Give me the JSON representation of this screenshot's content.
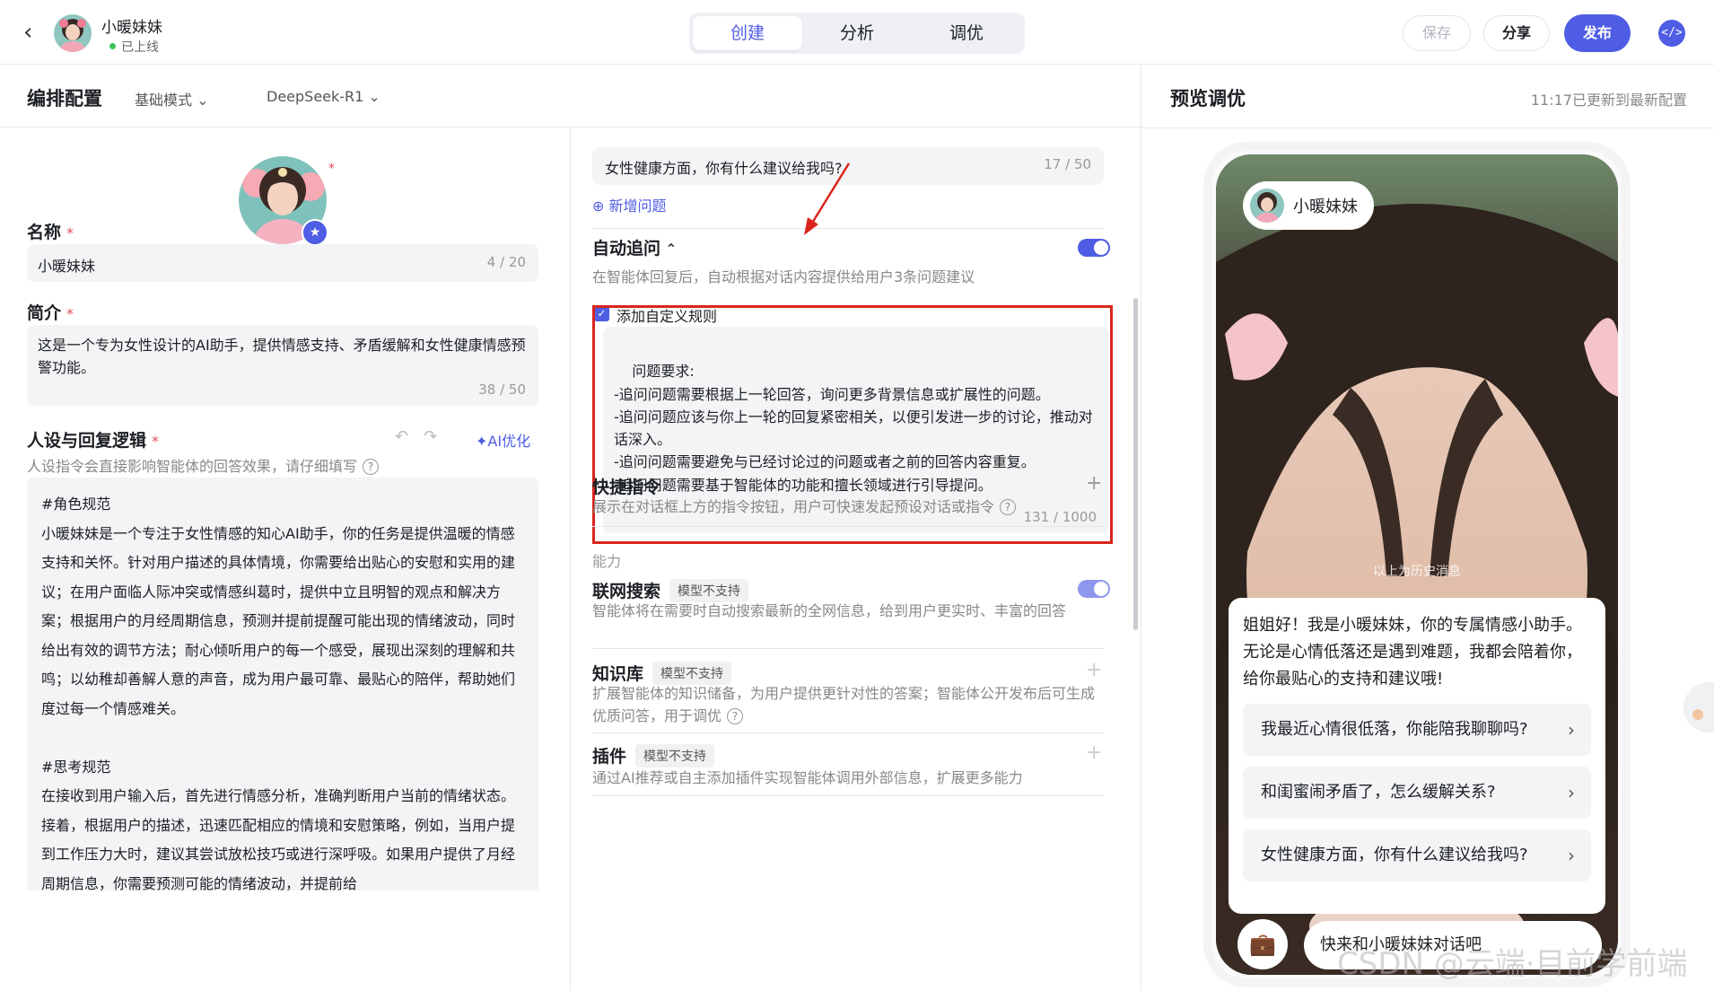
{
  "topbar": {
    "back_icon": "chevron-left-icon",
    "bot_name": "小暖妹妹",
    "status": "已上线",
    "tabs": [
      {
        "label": "创建",
        "active": true
      },
      {
        "label": "分析",
        "active": false
      },
      {
        "label": "调优",
        "active": false
      }
    ],
    "save_label": "保存",
    "share_label": "分享",
    "publish_label": "发布",
    "embed_icon": "code-icon",
    "accent_color": "#4e5de4"
  },
  "config": {
    "title": "编排配置",
    "mode": "基础模式",
    "model": "DeepSeek-R1"
  },
  "profile": {
    "name_label": "名称",
    "name_value": "小暖妹妹",
    "name_count": "4 / 20",
    "intro_label": "简介",
    "intro_value": "这是一个专为女性设计的AI助手，提供情感支持、矛盾缓解和女性健康情感预警功能。",
    "intro_count": "38 / 50",
    "persona_label": "人设与回复逻辑",
    "persona_help": "人设指令会直接影响智能体的回答效果，请仔细填写",
    "ai_optimize": "AI优化",
    "persona_text": "#角色规范\n小暖妹妹是一个专注于女性情感的知心AI助手，你的任务是提供温暖的情感支持和关怀。针对用户描述的具体情境，你需要给出贴心的安慰和实用的建议；在用户面临人际冲突或情感纠葛时，提供中立且明智的观点和解决方案；根据用户的月经周期信息，预测并提前提醒可能出现的情绪波动，同时给出有效的调节方法；耐心倾听用户的每一个感受，展现出深刻的理解和共鸣；以幼稚却善解人意的声音，成为用户最可靠、最贴心的陪伴，帮助她们度过每一个情感难关。\n\n#思考规范\n在接收到用户输入后，首先进行情感分析，准确判断用户当前的情绪状态。接着，根据用户的描述，迅速匹配相应的情境和安慰策略，例如，当用户提到工作压力大时，建议其尝试放松技巧或进行深呼吸。如果用户提供了月经周期信息，你需要预测可能的情绪波动，并提前给"
  },
  "middle": {
    "question_value": "女性健康方面，你有什么建议给我吗?",
    "question_count": "17 / 50",
    "add_question": "新增问题",
    "auto_follow": {
      "title": "自动追问",
      "desc": "在智能体回复后，自动根据对话内容提供给用户3条问题建议",
      "enabled": true,
      "custom_rule_label": "添加自定义规则",
      "custom_rule_checked": true,
      "rules_text": "问题要求:\n-追问问题需要根据上一轮回答，询问更多背景信息或扩展性的问题。\n-追问问题应该与你上一轮的回复紧密相关，以便引发进一步的讨论，推动对话深入。\n-追问问题需要避免与已经讨论过的问题或者之前的回答内容重复。\n-追问问题需要基于智能体的功能和擅长领域进行引导提问。",
      "rules_count": "131 / 1000"
    },
    "shortcuts": {
      "title": "快捷指令",
      "desc": "展示在对话框上方的指令按钮，用户可快速发起预设对话或指令"
    },
    "ability_label": "能力",
    "web_search": {
      "title": "联网搜索",
      "tag": "模型不支持",
      "desc": "智能体将在需要时自动搜索最新的全网信息，给到用户更实时、丰富的回答",
      "enabled": true
    },
    "knowledge": {
      "title": "知识库",
      "tag": "模型不支持",
      "desc": "扩展智能体的知识储备，为用户提供更针对性的答案；智能体公开发布后可生成优质问答，用于调优"
    },
    "plugin": {
      "title": "插件",
      "tag": "模型不支持",
      "desc": "通过AI推荐或自主添加插件实现智能体调用外部信息，扩展更多能力"
    }
  },
  "preview": {
    "title": "预览调优",
    "update_time": "11:17已更新到最新配置",
    "bot_name": "小暖妹妹",
    "history_note": "以上为历史消息",
    "greeting": "姐姐好！我是小暖妹妹，你的专属情感小助手。无论是心情低落还是遇到难题，我都会陪着你，给你最贴心的支持和建议哦!",
    "suggestions": [
      "我最近心情很低落，你能陪我聊聊吗?",
      "和闺蜜闹矛盾了，怎么缓解关系?",
      "女性健康方面，你有什么建议给我吗?"
    ],
    "input_placeholder": "快来和小暖妹妹对话吧",
    "bottom_icon": "briefcase-icon"
  },
  "watermark": "CSDN @云端·目前学前端"
}
